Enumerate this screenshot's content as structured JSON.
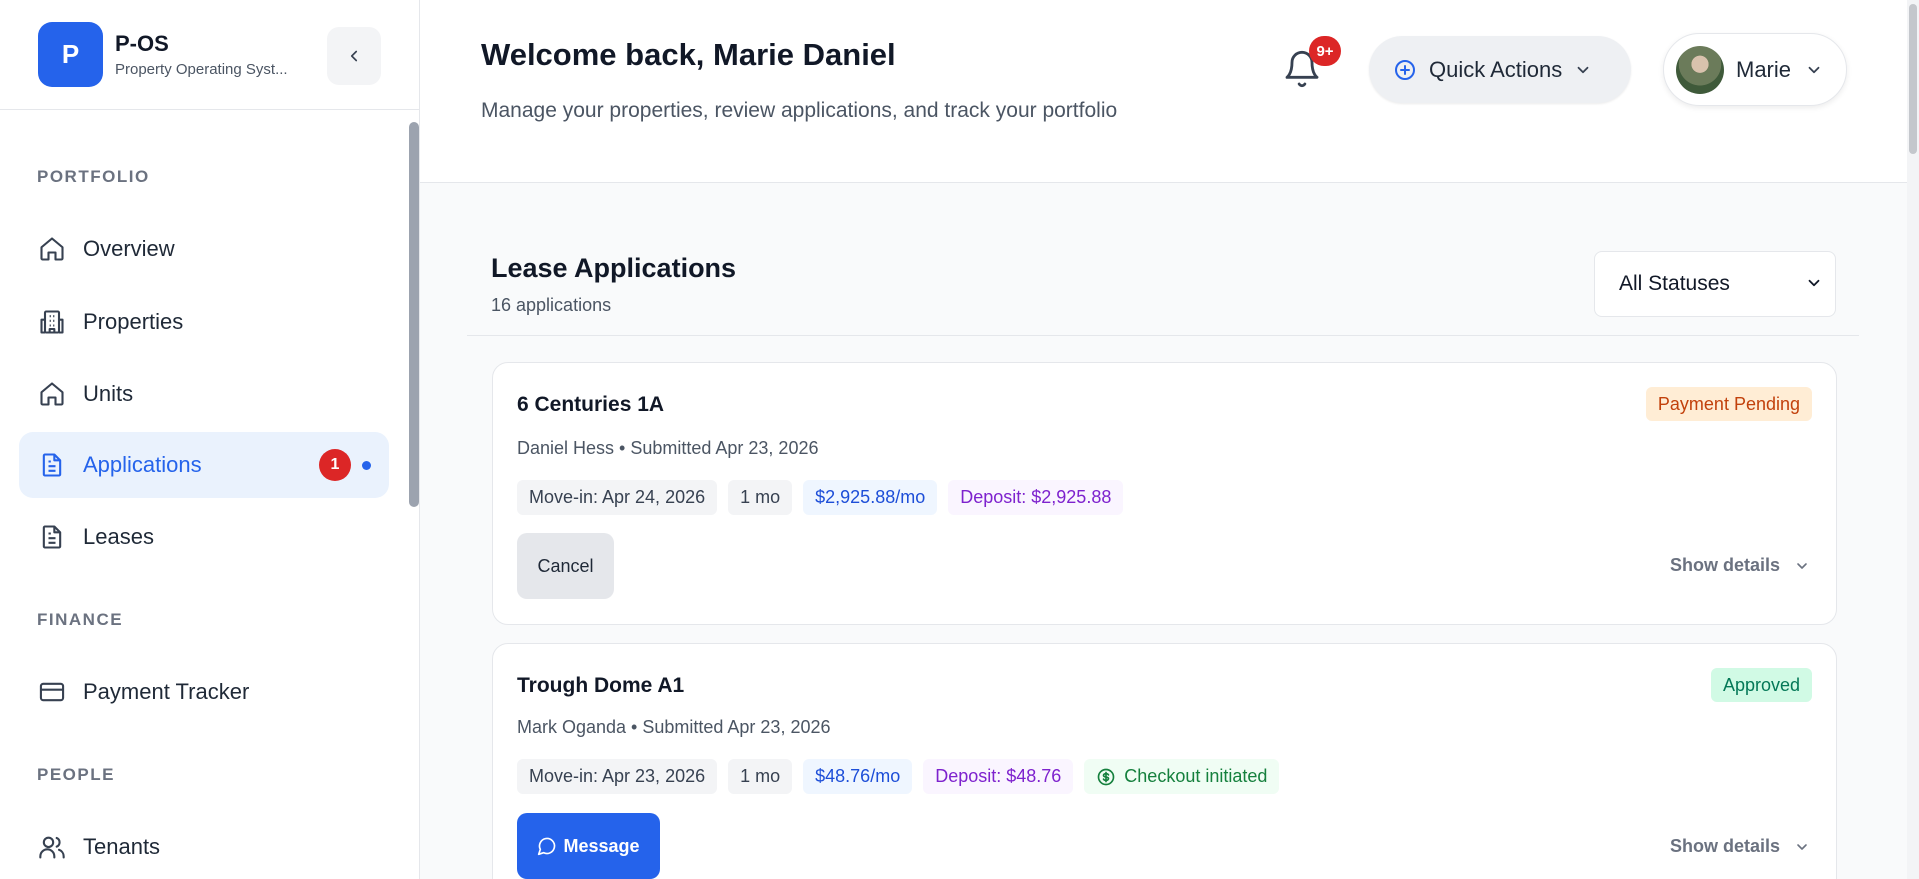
{
  "brand": {
    "logo_letter": "P",
    "name": "P-OS",
    "subtitle": "Property Operating Syst..."
  },
  "sidebar": {
    "sections": [
      {
        "label": "PORTFOLIO"
      },
      {
        "label": "FINANCE"
      },
      {
        "label": "PEOPLE"
      }
    ],
    "items": [
      {
        "label": "Overview",
        "icon": "home-icon"
      },
      {
        "label": "Properties",
        "icon": "building-icon"
      },
      {
        "label": "Units",
        "icon": "home-icon"
      },
      {
        "label": "Applications",
        "icon": "document-icon",
        "active": true,
        "badge": "1"
      },
      {
        "label": "Leases",
        "icon": "document-icon"
      },
      {
        "label": "Payment Tracker",
        "icon": "credit-card-icon"
      },
      {
        "label": "Tenants",
        "icon": "users-icon"
      }
    ]
  },
  "header": {
    "title": "Welcome back, Marie Daniel",
    "subtitle": "Manage your properties, review applications, and track your portfolio",
    "notifications_badge": "9+",
    "quick_actions_label": "Quick Actions",
    "user_name": "Marie"
  },
  "applications": {
    "title": "Lease Applications",
    "count_text": "16 applications",
    "filter_value": "All Statuses",
    "cards": [
      {
        "title": "6 Centuries 1A",
        "meta": "Daniel Hess • Submitted Apr 23, 2026",
        "status": "Payment Pending",
        "move_in": "Move-in: Apr 24, 2026",
        "term": "1 mo",
        "rent": "$2,925.88/mo",
        "deposit": "Deposit: $2,925.88",
        "action": "Cancel",
        "show_details": "Show details"
      },
      {
        "title": "Trough Dome A1",
        "meta": "Mark Oganda • Submitted Apr 23, 2026",
        "status": "Approved",
        "move_in": "Move-in: Apr 23, 2026",
        "term": "1 mo",
        "rent": "$48.76/mo",
        "deposit": "Deposit: $48.76",
        "extra": "Checkout initiated",
        "action": "Message",
        "show_details": "Show details"
      }
    ]
  },
  "colors": {
    "accent": "#2563eb",
    "badge": "#dc2626",
    "pending": "#c2410c",
    "approved": "#047857"
  }
}
